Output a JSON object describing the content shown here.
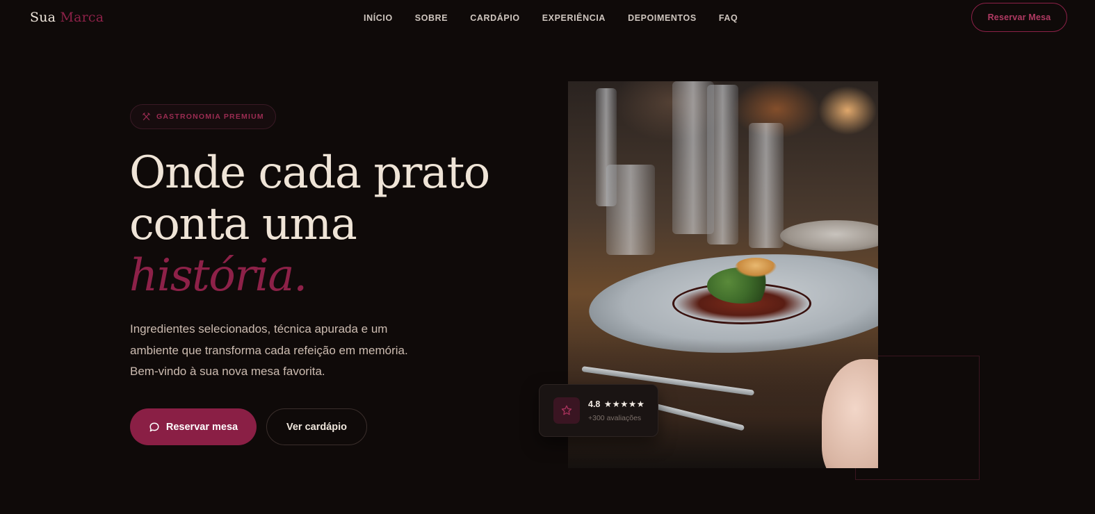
{
  "header": {
    "brand": {
      "name": "Sua",
      "accent": "Marca"
    },
    "nav": [
      "INÍCIO",
      "SOBRE",
      "CARDÁPIO",
      "EXPERIÊNCIA",
      "DEPOIMENTOS",
      "FAQ"
    ],
    "cta_label": "Reservar Mesa"
  },
  "hero": {
    "badge": {
      "icon": "utensils-crossed-icon",
      "label": "GASTRONOMIA PREMIUM"
    },
    "headline": {
      "line1": "Onde cada prato",
      "line2": "conta uma",
      "highlight": "história."
    },
    "lead": "Ingredientes selecionados, técnica apurada e um ambiente que transforma cada refeição em memória. Bem-vindo à sua nova mesa favorita.",
    "primary_button": {
      "icon": "chat-icon",
      "label": "Reservar mesa"
    },
    "secondary_button": {
      "label": "Ver cardápio"
    }
  },
  "rating": {
    "icon": "star-icon",
    "score": "4.8",
    "stars": "★★★★★",
    "count": "+300 avaliações"
  },
  "colors": {
    "background": "#0f0a09",
    "accent": "#8d2148",
    "text": "#efe4d7"
  }
}
